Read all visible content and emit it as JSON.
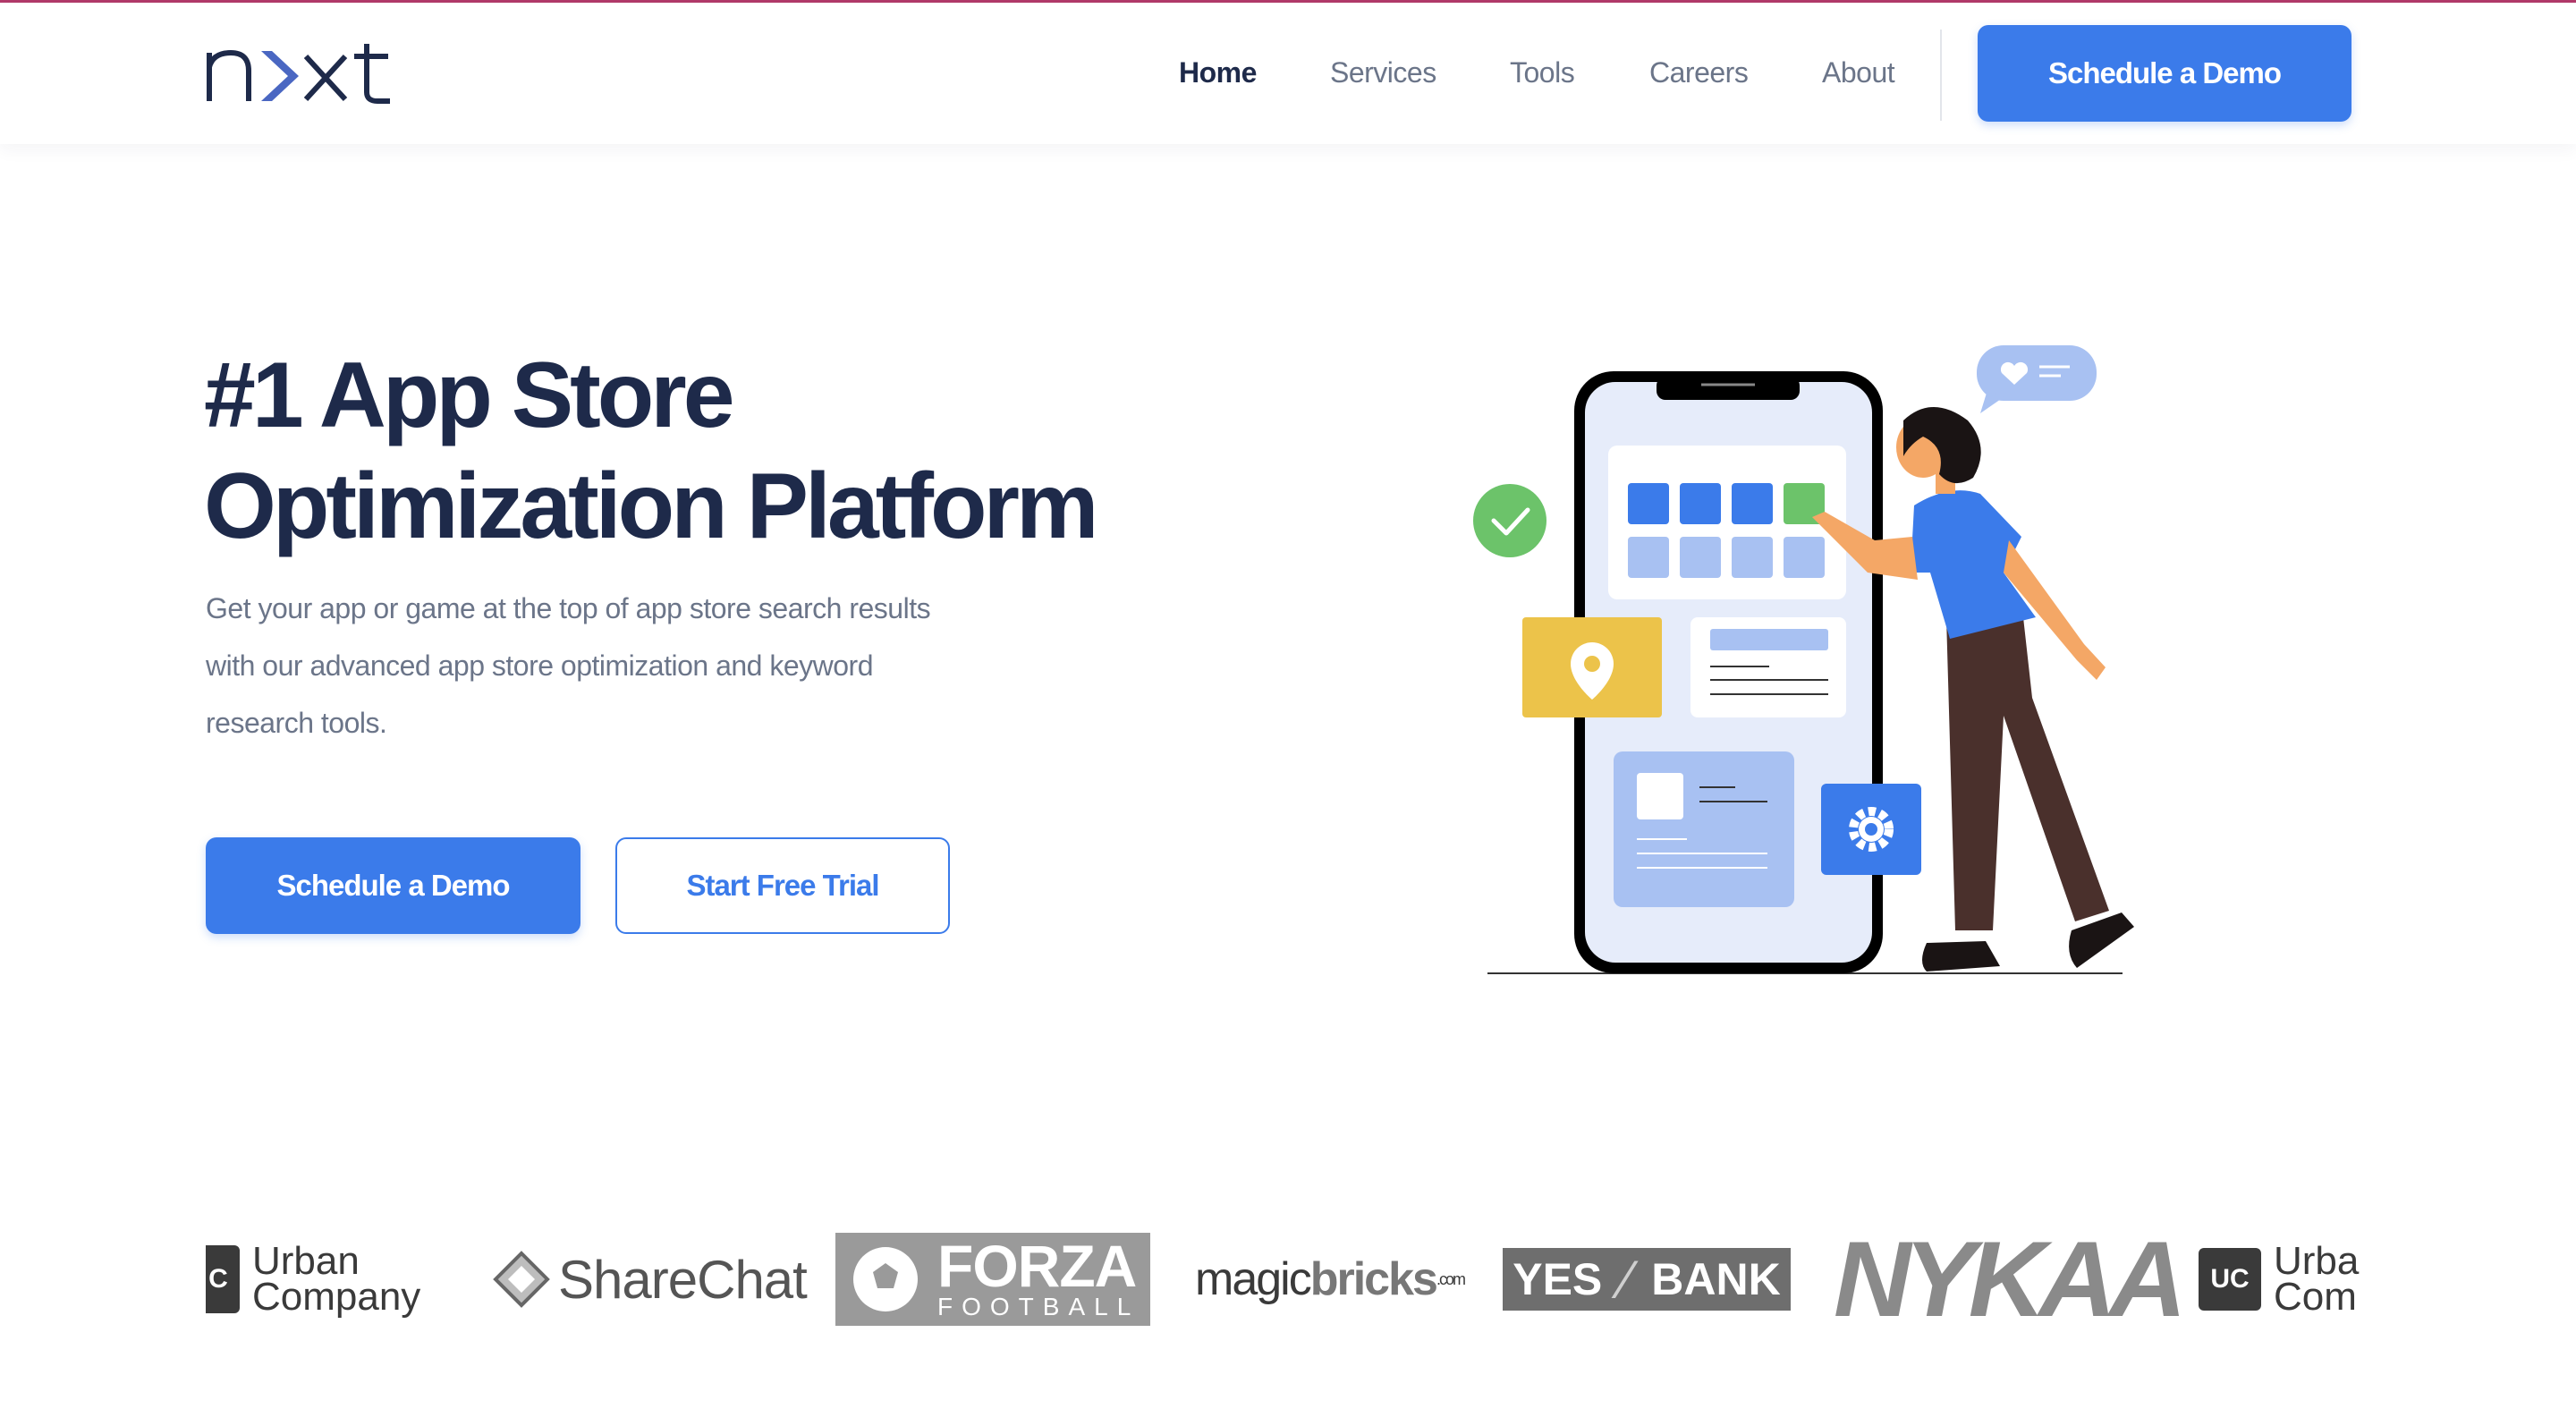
{
  "brand": {
    "logo_text": "nxt"
  },
  "nav": {
    "items": [
      {
        "label": "Home",
        "active": true
      },
      {
        "label": "Services",
        "active": false
      },
      {
        "label": "Tools",
        "active": false
      },
      {
        "label": "Careers",
        "active": false
      },
      {
        "label": "About",
        "active": false
      }
    ],
    "cta_label": "Schedule a Demo"
  },
  "hero": {
    "title_line1": "#1 App Store",
    "title_line2": "Optimization Platform",
    "subtitle": "Get your app or game at the top of app store search results with our advanced app store optimization and keyword research tools.",
    "primary_button": "Schedule a Demo",
    "secondary_button": "Start Free Trial"
  },
  "clients": {
    "logos": [
      {
        "name": "Urban Company",
        "line1": "Urban",
        "line2": "Company",
        "mark": "C"
      },
      {
        "name": "ShareChat",
        "text": "ShareChat"
      },
      {
        "name": "Forza Football",
        "line1": "FORZA",
        "line2": "FOOTBALL"
      },
      {
        "name": "magicbricks",
        "part1": "magic",
        "part2": "bricks",
        "suffix": ".com"
      },
      {
        "name": "YES BANK",
        "part1": "YES",
        "part2": "BANK"
      },
      {
        "name": "NYKAA",
        "text": "NYKAA"
      },
      {
        "name": "Urban Company",
        "line1": "Urba",
        "line2": "Com",
        "mark": "UC"
      }
    ]
  },
  "colors": {
    "accent": "#3b7bea",
    "heading": "#1e2a4a",
    "muted": "#6b7589",
    "check_green": "#6cc36a",
    "pin_yellow": "#ecc34a"
  }
}
